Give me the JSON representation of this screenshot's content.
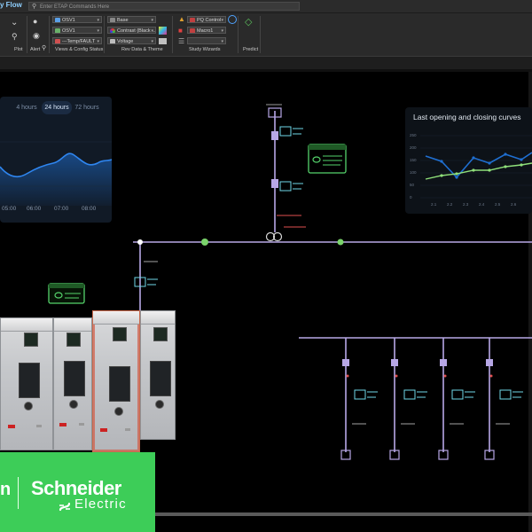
{
  "ribbon": {
    "tab_title": "y Flow",
    "search_placeholder": "Enter ETAP Commands Here",
    "combos": {
      "osv1_a": "OSV1",
      "osv1_b": "OSV1",
      "temp": "---Temp/FAULT",
      "base": "Base",
      "contrast": "Contrast (Black ...",
      "voltage": "Voltage",
      "pq_control": "PQ Control",
      "macro": "Macro1",
      "blank": ""
    },
    "groups": {
      "plot": "Plot",
      "alert": "Alert",
      "views": "Views & Config Status",
      "rev_data": "Rev Data & Theme",
      "study_wizards": "Study Wizards",
      "predict": "Predict"
    }
  },
  "left_card": {
    "segments": [
      "4 hours",
      "24 hours",
      "72 hours"
    ],
    "active_segment": 1,
    "x_ticks": [
      "05:00",
      "06:00",
      "07:00",
      "08:00"
    ]
  },
  "right_card": {
    "title": "Last opening and closing curves",
    "y_ticks": [
      "250",
      "200",
      "150",
      "100",
      "50",
      "0"
    ],
    "x_ticks": [
      "2.1",
      "2.2",
      "2.3",
      "2.4",
      "2.5",
      "2.6"
    ]
  },
  "brand": {
    "fragment": "n",
    "name": "Schneider",
    "sub": "Electric"
  },
  "colors": {
    "bus": "#b7a7e6",
    "node": "#7ad36b",
    "chart_blue": "#1f6fd1",
    "chart_green": "#8fe07a",
    "brand_green": "#3dcd58"
  }
}
